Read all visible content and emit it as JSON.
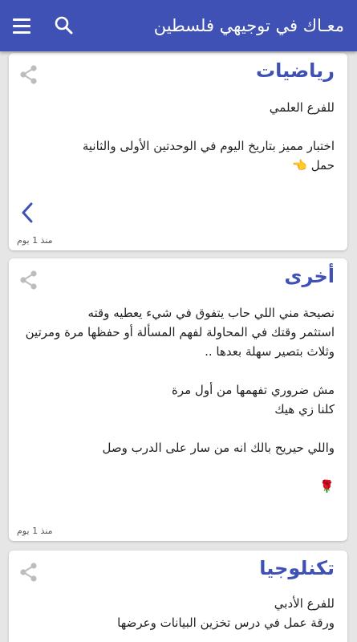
{
  "appbar": {
    "title": "معـاك في توجيهي فلسطين",
    "menu_icon": "menu-icon",
    "search_icon": "search-icon",
    "color": "#3f51b5"
  },
  "posts": [
    {
      "category": "رياضيات",
      "lines": [
        "للفرع العلمي",
        "",
        "اختبار مميز بتاريخ اليوم في الوحدتين الأولى والثانية",
        "حمل 👈"
      ],
      "time": "منذ 1 يوم",
      "has_prev_arrow": true
    },
    {
      "category": "أخرى",
      "lines": [
        "نصيحة مني اللي حاب يتفوق في شيء يعطيه وقته",
        "استثمر وقتك في المحاولة لفهم المسألة أو حفظها مرة ومرتين",
        "وثلاث بتصير سهلة بعدها ..",
        "",
        "مش ضروري تفهمها من أول مرة",
        "كلنا زي هيك",
        "",
        "واللي حيريح بالك انه من سار على الدرب وصل",
        "",
        "🌹"
      ],
      "time": "منذ 1 يوم"
    },
    {
      "category": "تكنلوجيا",
      "lines": [
        "للفرع الأدبي",
        "ورقة عمل في درس تخزين البيانات وعرضها"
      ],
      "time": ""
    }
  ]
}
